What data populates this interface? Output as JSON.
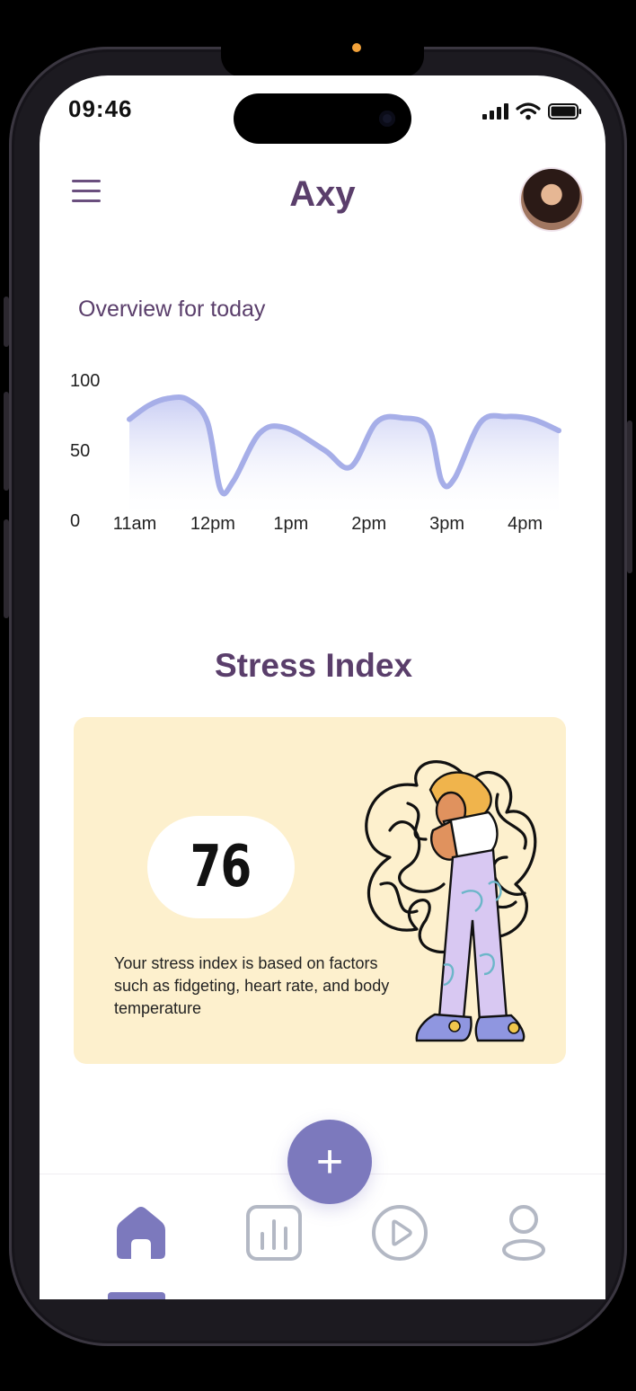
{
  "status_bar": {
    "time": "09:46"
  },
  "header": {
    "title": "Axy"
  },
  "overview": {
    "title": "Overview for today"
  },
  "chart_data": {
    "type": "area",
    "title": "Overview for today",
    "y_ticks": [
      "100",
      "50",
      "0"
    ],
    "ylim": [
      0,
      100
    ],
    "x_tick_labels": [
      "11am",
      "12pm",
      "1pm",
      "2pm",
      "3pm",
      "4pm"
    ],
    "series": [
      {
        "x": [
          "11:00",
          "11:15",
          "11:30",
          "11:45",
          "12:00",
          "12:10",
          "12:20",
          "12:40",
          "1:00",
          "1:30",
          "1:50",
          "2:10",
          "2:30",
          "2:50",
          "3:00",
          "3:10",
          "3:30",
          "3:50",
          "4:10",
          "4:30"
        ],
        "values": [
          72,
          82,
          87,
          86,
          70,
          22,
          28,
          62,
          66,
          50,
          38,
          70,
          73,
          66,
          28,
          30,
          70,
          74,
          72,
          64
        ]
      }
    ],
    "color": "#a6aee8",
    "grid": false
  },
  "stress": {
    "title": "Stress Index",
    "value": "76",
    "description": "Your stress index is based on factors such as fidgeting, heart rate, and body temperature"
  },
  "fab": {
    "label": "+"
  },
  "nav": {
    "items": [
      "home-icon",
      "stats-icon",
      "play-icon",
      "profile-icon"
    ],
    "active": "home-icon",
    "accent": "#7c79bd",
    "inactive": "#b3b8c4"
  }
}
